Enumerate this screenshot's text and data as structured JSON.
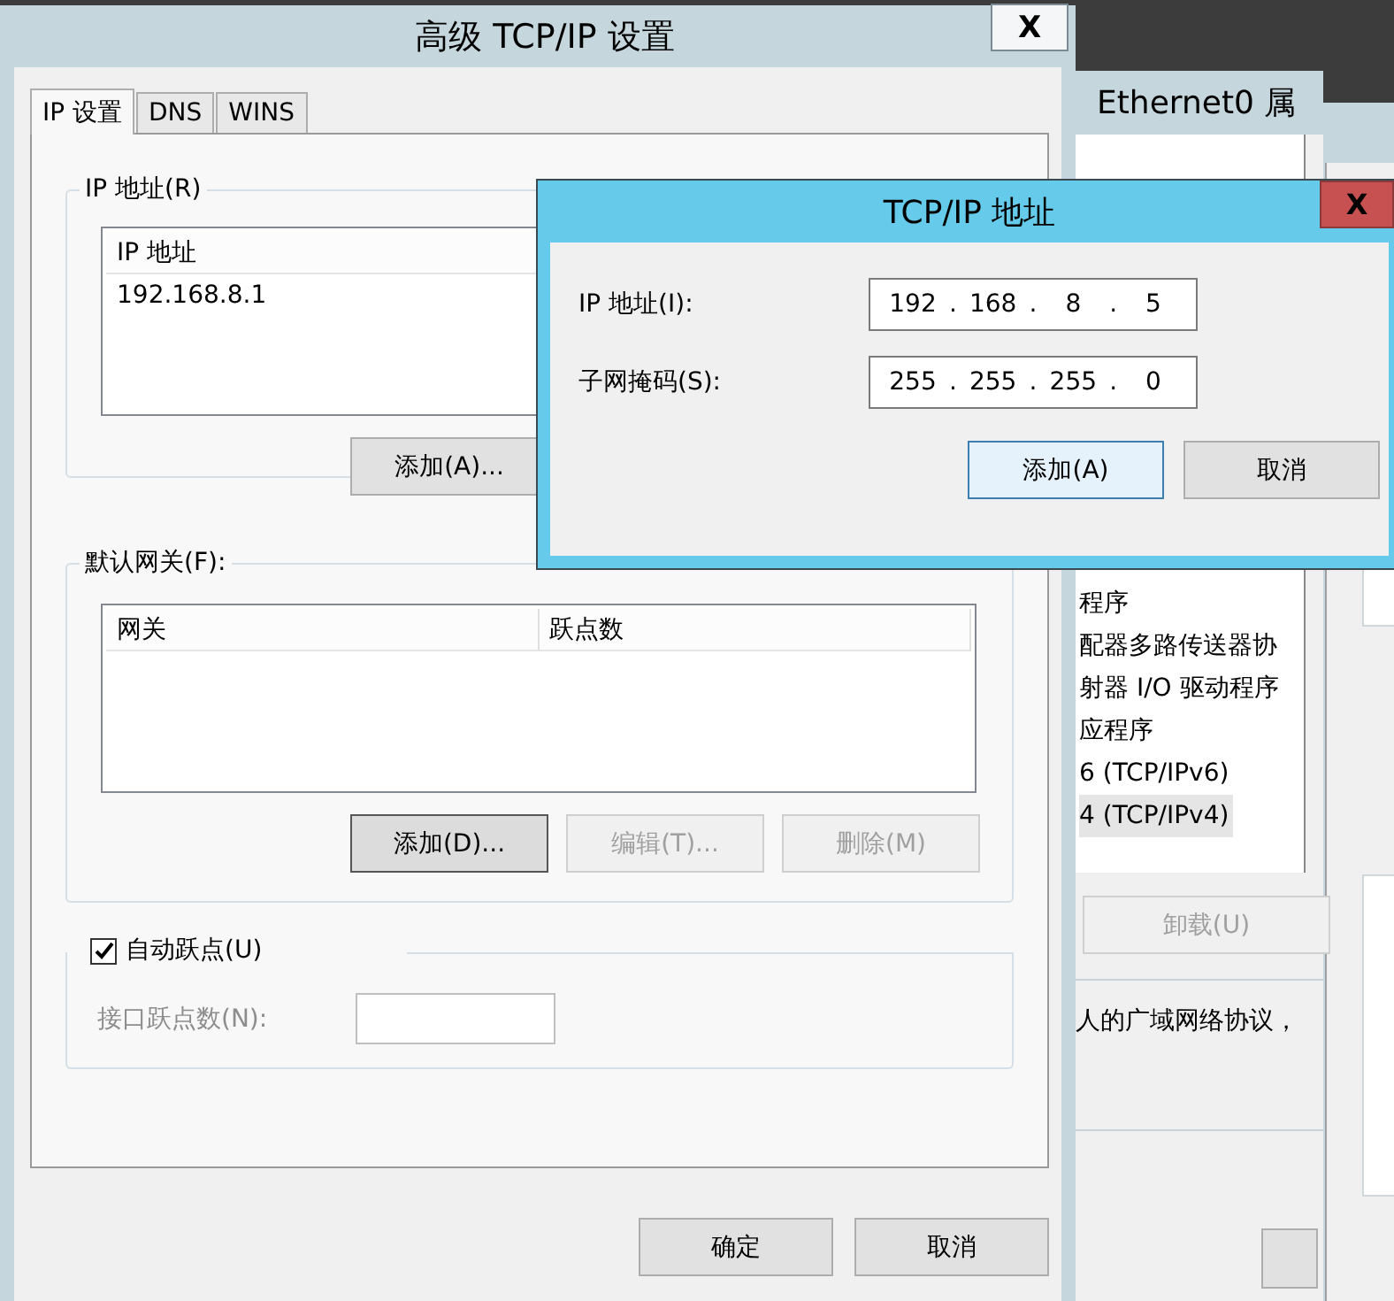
{
  "main_window": {
    "title": "高级 TCP/IP 设置",
    "close": "X",
    "tabs": [
      {
        "label": "IP 设置",
        "selected": true
      },
      {
        "label": "DNS",
        "selected": false
      },
      {
        "label": "WINS",
        "selected": false
      }
    ],
    "ip_group": {
      "label": "IP 地址(R)",
      "columns": [
        "IP 地址"
      ],
      "rows": [
        "192.168.8.1"
      ],
      "buttons": [
        {
          "label": "添加(A)...",
          "disabled": false,
          "default": false
        }
      ]
    },
    "gateway_group": {
      "label": "默认网关(F):",
      "columns": [
        "网关",
        "跃点数"
      ],
      "buttons": [
        {
          "label": "添加(D)...",
          "disabled": false,
          "default": true
        },
        {
          "label": "编辑(T)...",
          "disabled": true,
          "default": false
        },
        {
          "label": "删除(M)",
          "disabled": true,
          "default": false
        }
      ]
    },
    "auto_metric": {
      "label": "自动跃点(U)",
      "checked": true
    },
    "interface_metric": {
      "label": "接口跃点数(N):",
      "disabled": true
    },
    "buttons": [
      "确定",
      "取消"
    ]
  },
  "ethernet_window": {
    "title": "Ethernet0 属",
    "items": [
      {
        "label": "程序",
        "selected": false
      },
      {
        "label": "配器多路传送器协",
        "selected": false
      },
      {
        "label": "射器 I/O 驱动程序",
        "selected": false
      },
      {
        "label": "应程序",
        "selected": false
      },
      {
        "label": "6 (TCP/IPv6)",
        "selected": false
      },
      {
        "label": "4 (TCP/IPv4)",
        "selected": true
      }
    ],
    "uninstall_button": {
      "label": "卸载(U)",
      "disabled": true
    },
    "description": "人的广域网络协议，"
  },
  "address_dialog": {
    "title": "TCP/IP 地址",
    "close": "X",
    "separator": ".",
    "fields": [
      {
        "label": "IP 地址(I):",
        "octets": [
          "192",
          "168",
          "8",
          "5"
        ]
      },
      {
        "label": "子网掩码(S):",
        "octets": [
          "255",
          "255",
          "255",
          "0"
        ]
      }
    ],
    "buttons": [
      {
        "label": "添加(A)",
        "focused": true
      },
      {
        "label": "取消",
        "focused": false
      }
    ]
  }
}
